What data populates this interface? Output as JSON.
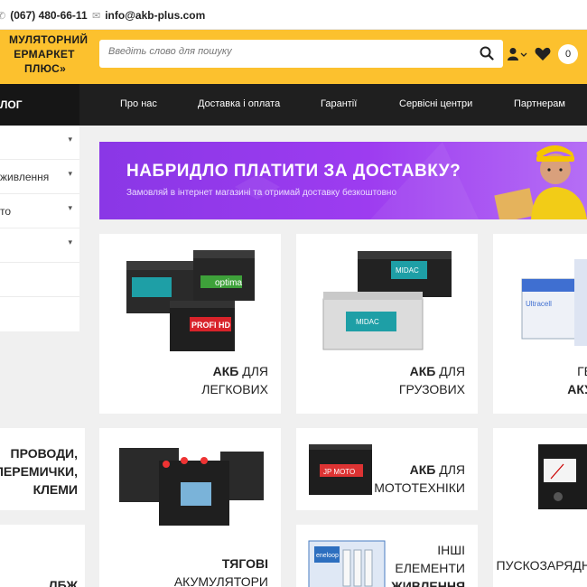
{
  "topbar": {
    "phone": "(067) 480-66-11",
    "email": "info@akb-plus.com"
  },
  "header": {
    "logo_lines": [
      "АКУМУЛЯТОРНИЙ",
      "СУПЕРМАРКЕТ",
      "«АКБ ПЛЮС»"
    ],
    "logo_visible": [
      "МУЛЯТОРНИЙ",
      "ЕРМАРКЕТ",
      "ПЛЮС»"
    ],
    "search_placeholder": "Введіть слово для пошуку",
    "cart_count": "0"
  },
  "nav": {
    "catalog_label": "ЛОГ",
    "links": [
      "Про нас",
      "Доставка і оплата",
      "Гарантії",
      "Сервісні центри",
      "Партнерам"
    ]
  },
  "sidebar": {
    "items": [
      "",
      "живлення",
      "то",
      "",
      "",
      ""
    ]
  },
  "banner": {
    "title": "НАБРИДЛО ПЛАТИТИ ЗА ДОСТАВКУ?",
    "subtitle": "Замовляй в інтернет магазині та отримай доставку безкоштовно"
  },
  "categories": [
    {
      "bold": "АКБ",
      "rest": " ДЛЯ",
      "line2": "ЛЕГКОВИХ"
    },
    {
      "bold": "АКБ",
      "rest": " ДЛЯ",
      "line2": "ГРУЗОВИХ"
    },
    {
      "line1": "ГЕ",
      "line2": "АКУ"
    },
    {
      "line1": "ПРОВОДИ,",
      "line2": "ПЕРЕМИЧКИ,",
      "line3": "КЛЕМИ"
    },
    {
      "line1": "ТЯГОВІ",
      "line2": "АКУМУЛЯТОРИ"
    },
    {
      "bold": "АКБ",
      "rest": " ДЛЯ",
      "line2": "МОТОТЕХНІКИ"
    },
    {
      "line1": "ПУСКОЗАРЯДН"
    },
    {
      "line1": "ЛБЖ"
    },
    {
      "line1": "ІНШІ",
      "line2": "ЕЛЕМЕНТИ",
      "line3": "ЖИВЛЕННЯ"
    }
  ],
  "product_labels": {
    "optima": "optima",
    "profi": "PROFI HD",
    "midac": "MIDAC",
    "jp": "JP MOTO",
    "ultracell": "Ultracell",
    "eneloop": "eneloop"
  },
  "colors": {
    "brand_yellow": "#fcc12e",
    "nav_dark": "#1f1f1f",
    "banner_purple": "#9d3cf0"
  }
}
